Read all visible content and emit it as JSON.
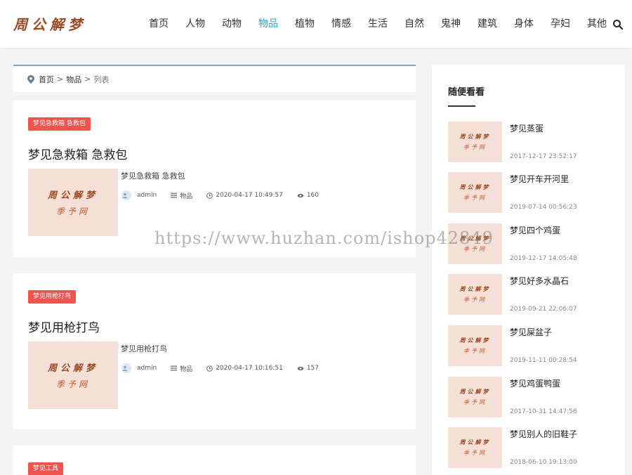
{
  "header": {
    "logo_text": "周公解梦",
    "nav": [
      {
        "label": "首页"
      },
      {
        "label": "人物"
      },
      {
        "label": "动物"
      },
      {
        "label": "物品",
        "active": true
      },
      {
        "label": "植物"
      },
      {
        "label": "情感"
      },
      {
        "label": "生活"
      },
      {
        "label": "自然"
      },
      {
        "label": "鬼神"
      },
      {
        "label": "建筑"
      },
      {
        "label": "身体"
      },
      {
        "label": "孕妇"
      },
      {
        "label": "其他"
      }
    ],
    "search_icon": "search-icon"
  },
  "breadcrumb": {
    "home": "首页",
    "category": "物品",
    "current": "列表",
    "separator": ">"
  },
  "thumbnail": {
    "line1": "周公解梦",
    "line2": "季予网"
  },
  "articles": [
    {
      "tag": "梦见急救箱 急救包",
      "title": "梦见急救箱 急救包",
      "excerpt": "梦见急救箱 急救包",
      "author": "admin",
      "category": "物品",
      "datetime": "2020-04-17 10:49:57",
      "views": "160"
    },
    {
      "tag": "梦见用枪打鸟",
      "title": "梦见用枪打鸟",
      "excerpt": "梦见用枪打鸟",
      "author": "admin",
      "category": "物品",
      "datetime": "2020-04-17 10:16:51",
      "views": "157"
    },
    {
      "tag": "梦见工具"
    }
  ],
  "sidebar": {
    "title": "随便看看",
    "items": [
      {
        "name": "梦见蒸蛋",
        "date": "2017-12-17 23:52:17"
      },
      {
        "name": "梦见开车开河里",
        "date": "2019-07-14 00:56:23"
      },
      {
        "name": "梦见四个鸡蛋",
        "date": "2019-12-17 14:05:48"
      },
      {
        "name": "梦见好多水晶石",
        "date": "2019-09-21 22:06:07"
      },
      {
        "name": "梦见屎盆子",
        "date": "2019-11-11 00:28:54"
      },
      {
        "name": "梦见鸡蛋鸭蛋",
        "date": "2017-10-31 14:47:58"
      },
      {
        "name": "梦见别人的旧鞋子",
        "date": "2018-06-10 19:13:00"
      }
    ]
  },
  "watermark": "https://www.huzhan.com/ishop42849",
  "colors": {
    "accent": "#2aa3d6",
    "tag": "#f0544f",
    "logo": "#9b4a22",
    "thumb_bg": "#f5e0d7"
  }
}
